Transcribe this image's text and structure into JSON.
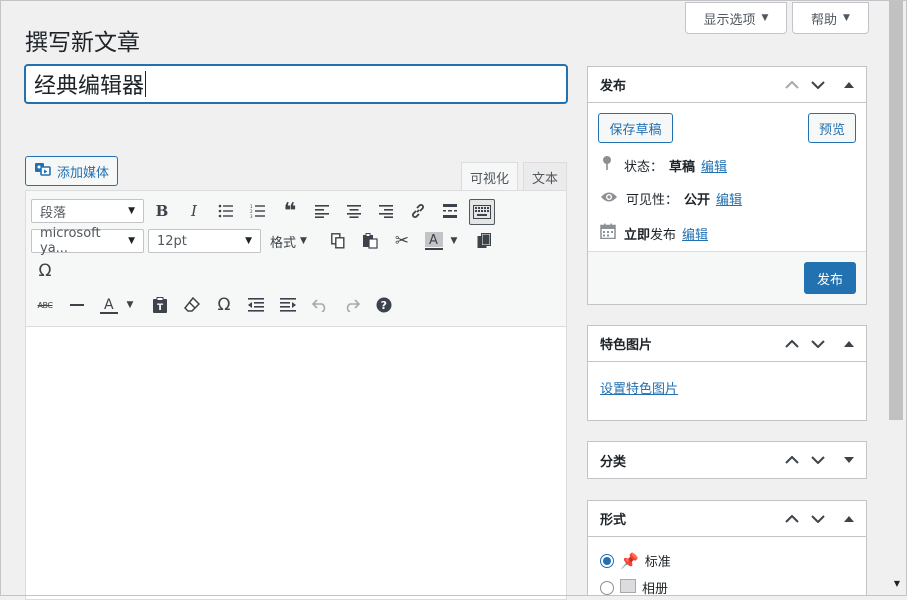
{
  "header": {
    "screen_options_label": "显示选项",
    "help_label": "帮助",
    "page_title": "撰写新文章"
  },
  "title_field": {
    "value": "经典编辑器"
  },
  "media": {
    "add_media_label": "添加媒体"
  },
  "editor_tabs": {
    "visual": "可视化",
    "text": "文本"
  },
  "toolbar": {
    "format_select": "段落",
    "font_family": "microsoft ya...",
    "font_size": "12pt",
    "formats_label": "格式"
  },
  "publish_box": {
    "title": "发布",
    "save_draft": "保存草稿",
    "preview": "预览",
    "status_label": "状态：",
    "status_value": "草稿",
    "visibility_label": "可见性：",
    "visibility_value": "公开",
    "schedule_label": "立即",
    "schedule_suffix": "发布",
    "edit_link": "编辑",
    "publish_button": "发布"
  },
  "featured_image_box": {
    "title": "特色图片",
    "set_link": "设置特色图片"
  },
  "categories_box": {
    "title": "分类"
  },
  "format_box": {
    "title": "形式",
    "options": [
      {
        "label": "标准",
        "checked": true
      },
      {
        "label": "相册",
        "checked": false
      }
    ]
  },
  "colors": {
    "accent": "#2271b1",
    "background": "#f0f0f1",
    "border": "#c3c4c7"
  }
}
